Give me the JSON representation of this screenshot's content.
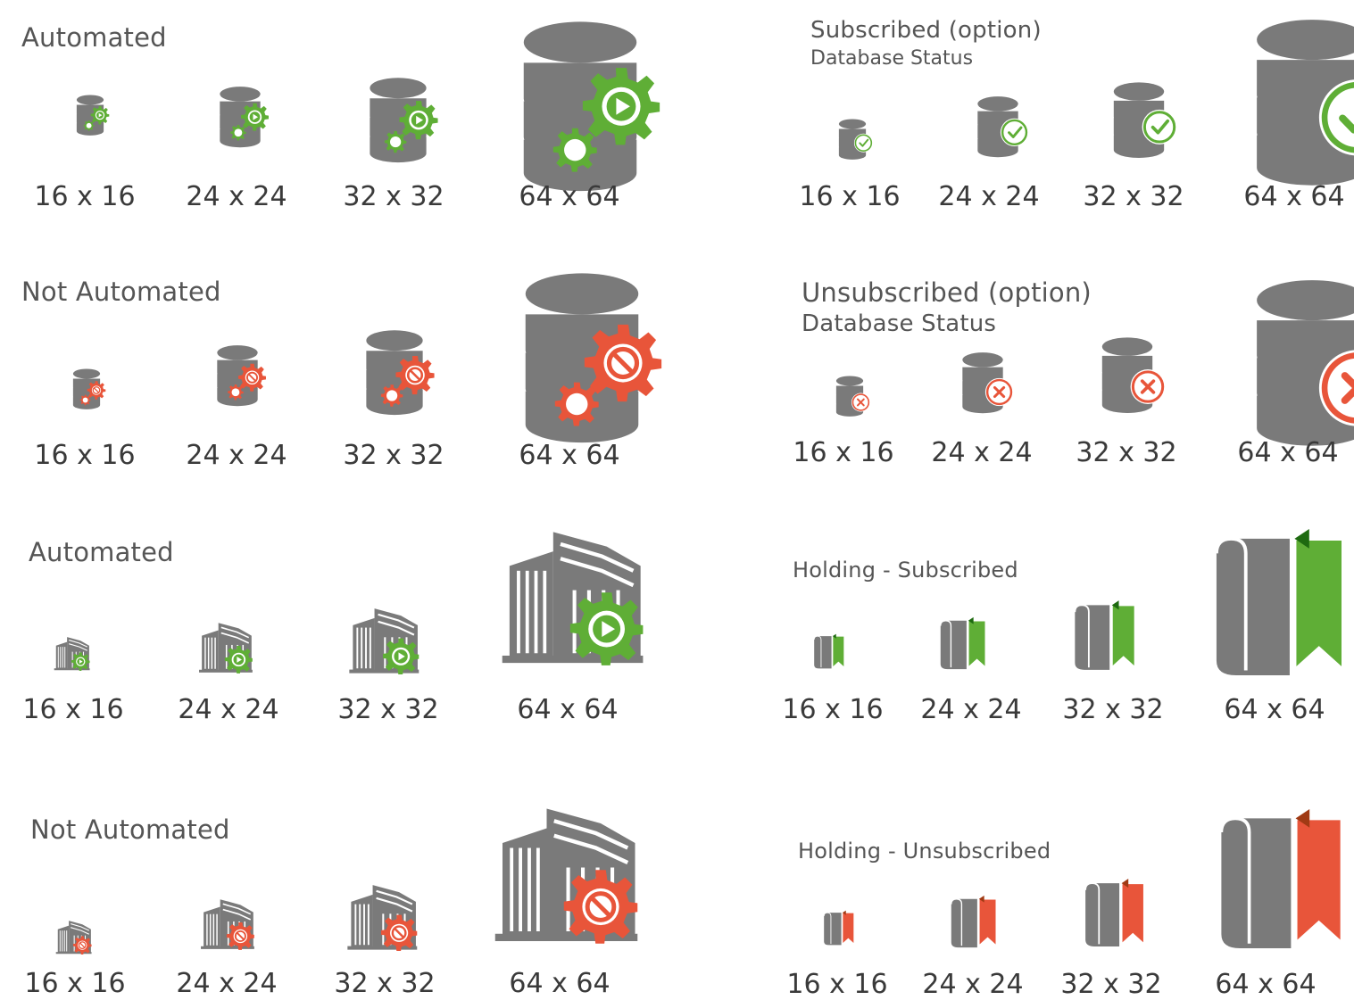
{
  "colors": {
    "gray": "#7a7a7a",
    "green": "#5fae36",
    "red": "#e8553a",
    "dark_green": "#1e6a10",
    "dark_red": "#a03a14"
  },
  "sections": [
    {
      "id": "db-automated",
      "title": "Automated",
      "subtitle": "",
      "icon": "database-gear-play-icon",
      "status_color": "green",
      "sizes": [
        "16 x 16",
        "24 x 24",
        "32 x 32",
        "64 x 64"
      ]
    },
    {
      "id": "db-subscribed",
      "title": "Subscribed   (option)",
      "subtitle": "Database Status",
      "icon": "database-check-icon",
      "status_color": "green",
      "sizes": [
        "16 x 16",
        "24 x 24",
        "32 x 32",
        "64 x 64"
      ]
    },
    {
      "id": "db-not-automated",
      "title": "Not Automated",
      "subtitle": "",
      "icon": "database-gear-blocked-icon",
      "status_color": "red",
      "sizes": [
        "16 x 16",
        "24 x 24",
        "32 x 32",
        "64 x 64"
      ]
    },
    {
      "id": "db-unsubscribed",
      "title": "Unsubscribed (option)",
      "subtitle": "Database Status",
      "icon": "database-cross-icon",
      "status_color": "red",
      "sizes": [
        "16 x 16",
        "24 x 24",
        "32 x 32",
        "64 x 64"
      ]
    },
    {
      "id": "bldg-automated",
      "title": "Automated",
      "subtitle": "",
      "icon": "building-gear-play-icon",
      "status_color": "green",
      "sizes": [
        "16 x 16",
        "24 x 24",
        "32 x 32",
        "64 x 64"
      ]
    },
    {
      "id": "holding-subscribed",
      "title": "Holding - Subscribed",
      "subtitle": "",
      "icon": "holding-bookmark-icon",
      "status_color": "green",
      "sizes": [
        "16 x 16",
        "24 x 24",
        "32 x 32",
        "64 x 64"
      ]
    },
    {
      "id": "bldg-not-automated",
      "title": "Not Automated",
      "subtitle": "",
      "icon": "building-gear-blocked-icon",
      "status_color": "red",
      "sizes": [
        "16 x 16",
        "24 x 24",
        "32 x 32",
        "64 x 64"
      ]
    },
    {
      "id": "holding-unsubscribed",
      "title": "Holding - Unsubscribed",
      "subtitle": "",
      "icon": "holding-bookmark-icon",
      "status_color": "red",
      "sizes": [
        "16 x 16",
        "24 x 24",
        "32 x 32",
        "64 x 64"
      ]
    }
  ]
}
